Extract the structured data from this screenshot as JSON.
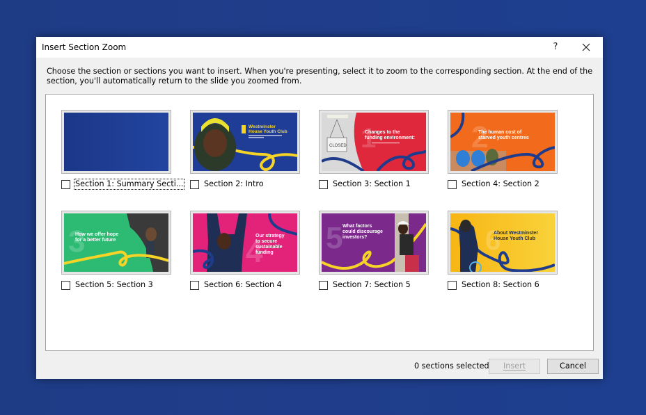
{
  "dialog": {
    "title": "Insert Section Zoom",
    "help_label": "?",
    "close_icon": "close-icon",
    "description": "Choose the section or sections you want to insert. When you're presenting, select it to zoom to the corresponding section. At the end of the section, you'll automatically return to the slide you zoomed from."
  },
  "sections": [
    {
      "label": "Section 1: Summary Secti...",
      "checked": false,
      "focused": true,
      "bg": "#1f3c96",
      "slide_number": "",
      "slide_title": "",
      "swirl": ""
    },
    {
      "label": "Section 2: Intro",
      "checked": false,
      "bg": "#1f3c96",
      "slide_number": "",
      "slide_title": "Westminster House Youth Club",
      "swirl": "#f5d327"
    },
    {
      "label": "Section 3: Section 1",
      "checked": false,
      "bg": "#e0283c",
      "slide_number": "1",
      "slide_title": "Changes to the funding environment:",
      "swirl": "#1f3c8c"
    },
    {
      "label": "Section 4: Section 2",
      "checked": false,
      "bg": "#f26a1b",
      "slide_number": "2",
      "slide_title": "The human cost of starved youth centres",
      "swirl": "#1f3c8c"
    },
    {
      "label": "Section 5: Section 3",
      "checked": false,
      "bg": "#2dbb74",
      "slide_number": "3",
      "slide_title": "How we offer hope for a better future",
      "swirl": "#f5d327"
    },
    {
      "label": "Section 6: Section 4",
      "checked": false,
      "bg": "#e3237a",
      "slide_number": "4",
      "slide_title": "Our strategy to secure sustainable funding",
      "swirl": "#1f3c8c"
    },
    {
      "label": "Section 7: Section 5",
      "checked": false,
      "bg": "#7b2a8c",
      "slide_number": "5",
      "slide_title": "What factors could discourage investors?",
      "swirl": "#f5d327"
    },
    {
      "label": "Section 8: Section 6",
      "checked": false,
      "bg": "#f7b614",
      "slide_number": "6",
      "slide_title": "About Westminster House Youth Club",
      "swirl": "#1f3c8c"
    }
  ],
  "footer": {
    "status": "0 sections selected",
    "insert_label": "Insert",
    "cancel_label": "Cancel"
  }
}
